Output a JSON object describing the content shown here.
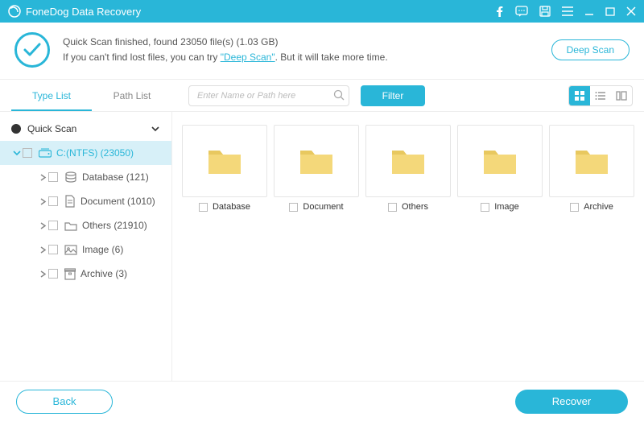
{
  "app_title": "FoneDog Data Recovery",
  "banner": {
    "line1_prefix": "Quick Scan finished, found ",
    "file_count": "23050",
    "line1_mid": " file(s) (",
    "total_size": "1.03 GB",
    "line1_suffix": ")",
    "line2_prefix": "If you can't find lost files, you can try ",
    "deep_link": "\"Deep Scan\"",
    "line2_suffix": ". But it will take more time.",
    "deep_scan_btn": "Deep Scan"
  },
  "toolbar": {
    "tab_type": "Type List",
    "tab_path": "Path List",
    "search_placeholder": "Enter Name or Path here",
    "filter": "Filter"
  },
  "tree": {
    "quick_scan": "Quick Scan",
    "drive": "C:(NTFS) (23050)",
    "items": [
      {
        "label": "Database (121)",
        "icon": "db"
      },
      {
        "label": "Document (1010)",
        "icon": "doc"
      },
      {
        "label": "Others (21910)",
        "icon": "folder"
      },
      {
        "label": "Image (6)",
        "icon": "image"
      },
      {
        "label": "Archive (3)",
        "icon": "archive"
      }
    ]
  },
  "grid": {
    "items": [
      "Database",
      "Document",
      "Others",
      "Image",
      "Archive"
    ]
  },
  "footer": {
    "back": "Back",
    "recover": "Recover"
  },
  "colors": {
    "accent": "#29b6d8"
  }
}
